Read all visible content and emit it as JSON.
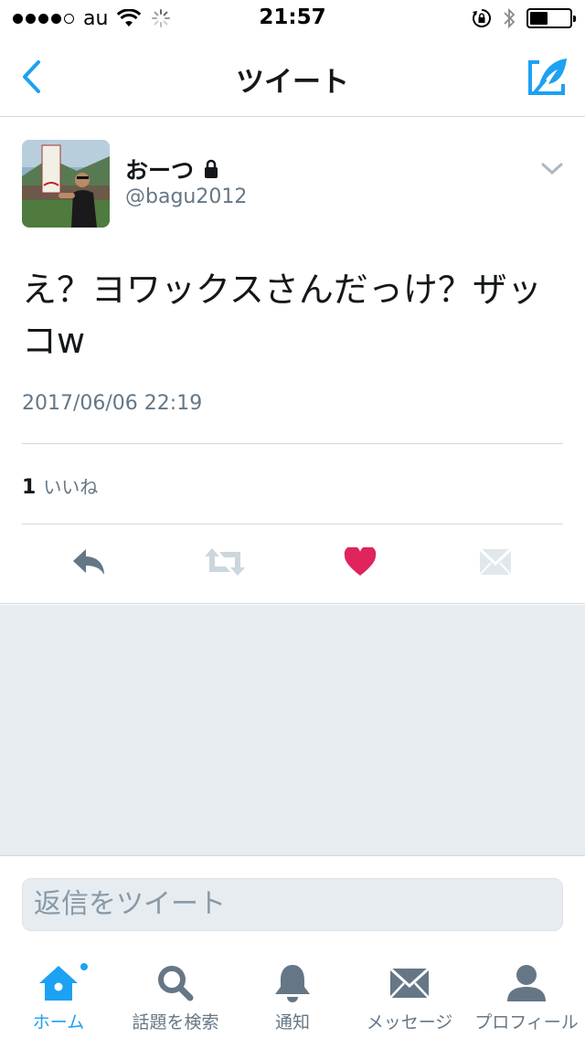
{
  "status_bar": {
    "carrier": "au",
    "time": "21:57",
    "signal_bars_filled": 4,
    "signal_bars_total": 5,
    "battery_level": 0.45
  },
  "nav": {
    "title": "ツイート",
    "back_icon": "chevron-left-icon",
    "compose_icon": "compose-quill-icon"
  },
  "tweet": {
    "display_name": "おーつ",
    "username": "@bagu2012",
    "text": "え？ヨワックスさんだっけ？ザッコw",
    "timestamp": "2017/06/06 22:19",
    "likes_count": "1",
    "likes_label": "いいね",
    "liked": true,
    "like_color": "#e0245e"
  },
  "reply": {
    "placeholder": "返信をツイート"
  },
  "tabs": [
    {
      "label": "ホーム",
      "icon": "home-icon",
      "active": true
    },
    {
      "label": "話題を検索",
      "icon": "search-icon",
      "active": false
    },
    {
      "label": "通知",
      "icon": "bell-icon",
      "active": false
    },
    {
      "label": "メッセージ",
      "icon": "envelope-icon",
      "active": false
    },
    {
      "label": "プロフィール",
      "icon": "person-icon",
      "active": false
    }
  ],
  "colors": {
    "accent": "#1da1f2",
    "secondary_text": "#657786",
    "background_grey": "#e6ecf0"
  }
}
